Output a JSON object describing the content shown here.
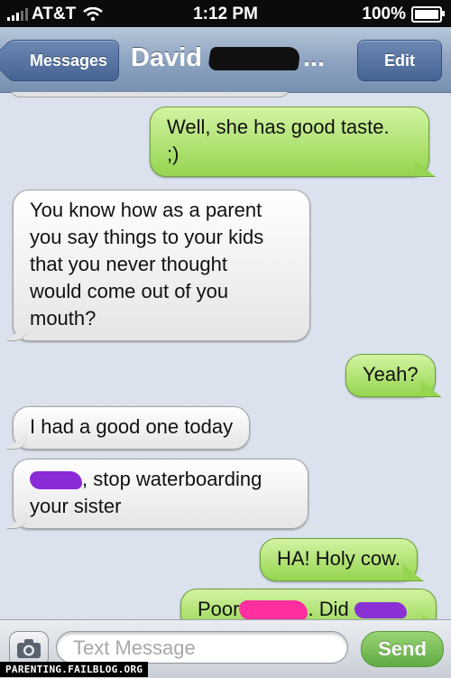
{
  "status_bar": {
    "carrier": "AT&T",
    "time": "1:12 PM",
    "battery": "100%"
  },
  "nav": {
    "back_label": "Messages",
    "title_visible": "David",
    "title_suffix": "...",
    "edit_label": "Edit"
  },
  "messages": [
    {
      "sender": "me",
      "lines": [
        "Well, she has good taste.",
        ";)"
      ]
    },
    {
      "sender": "david",
      "lines": [
        "You know how as a parent",
        "you say things to your kids",
        "that you never thought",
        "would come out of you",
        "mouth?"
      ]
    },
    {
      "sender": "me",
      "lines": [
        "Yeah?"
      ]
    },
    {
      "sender": "david",
      "lines": [
        "I had a good one today"
      ]
    },
    {
      "sender": "david",
      "lines": [
        ", stop waterboarding",
        "your sister"
      ]
    },
    {
      "sender": "me",
      "lines": [
        "HA! Holy cow."
      ]
    },
    {
      "sender": "me",
      "parts": [
        "Poor",
        ". Did"
      ]
    }
  ],
  "composer": {
    "placeholder": "Text Message",
    "send_label": "Send"
  },
  "watermark": "PARENTING.FAILBLOG.ORG",
  "colors": {
    "outgoing_bubble": "#95d54f",
    "incoming_bubble": "#e5e5e5",
    "nav_bar": "#8ea4c1",
    "background": "#dbe2ed",
    "redaction_purple": "#8a2bd8",
    "redaction_pink": "#ff2f9f"
  }
}
